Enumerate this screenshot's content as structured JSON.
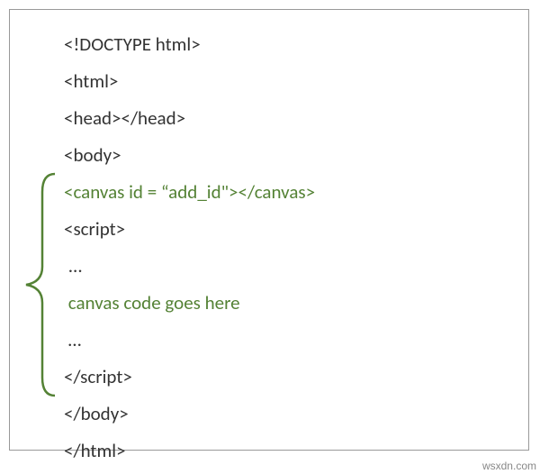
{
  "lines": {
    "l1": "<!DOCTYPE html>",
    "l2": "<html>",
    "l3": "<head></head>",
    "l4": "<body>",
    "l5": "<canvas id = “add_id\"></canvas>",
    "l6": "<script>",
    "l7": " ...",
    "l8": " canvas code goes here",
    "l9": " …",
    "l10": "</script>",
    "l11": "</body>",
    "l12": "</html>"
  },
  "watermark": "wsxdn.com",
  "colors": {
    "highlight": "#548235",
    "brace": "#548235"
  }
}
